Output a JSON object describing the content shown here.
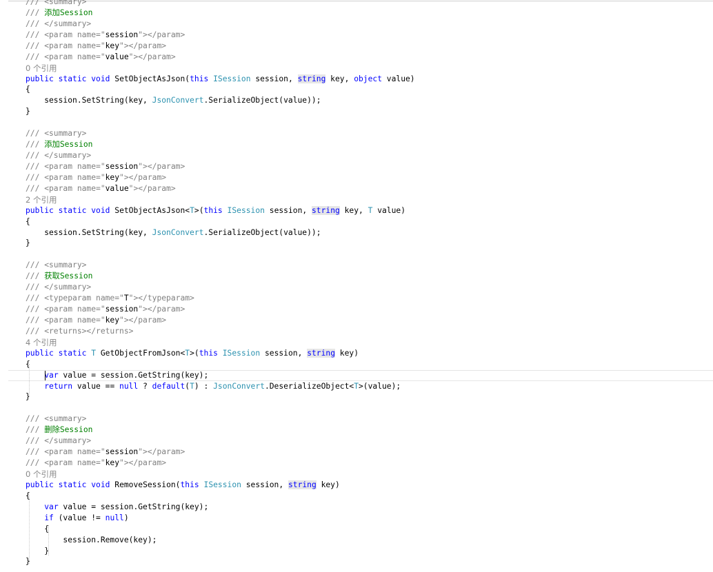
{
  "lines": [
    {
      "kind": "code",
      "tokens": [
        [
          "doc",
          "/// <summary>"
        ]
      ]
    },
    {
      "kind": "code",
      "tokens": [
        [
          "doc",
          "/// "
        ],
        [
          "com",
          "添加Session"
        ]
      ]
    },
    {
      "kind": "code",
      "tokens": [
        [
          "doc",
          "/// </summary>"
        ]
      ]
    },
    {
      "kind": "code",
      "tokens": [
        [
          "doc",
          "/// <param name=\""
        ],
        [
          "str",
          "session"
        ],
        [
          "doc",
          "\"></param>"
        ]
      ]
    },
    {
      "kind": "code",
      "tokens": [
        [
          "doc",
          "/// <param name=\""
        ],
        [
          "str",
          "key"
        ],
        [
          "doc",
          "\"></param>"
        ]
      ]
    },
    {
      "kind": "code",
      "tokens": [
        [
          "doc",
          "/// <param name=\""
        ],
        [
          "str",
          "value"
        ],
        [
          "doc",
          "\"></param>"
        ]
      ]
    },
    {
      "kind": "lens",
      "text": "0 个引用"
    },
    {
      "kind": "code",
      "tokens": [
        [
          "kw",
          "public"
        ],
        [
          "plain",
          " "
        ],
        [
          "kw",
          "static"
        ],
        [
          "plain",
          " "
        ],
        [
          "kw",
          "void"
        ],
        [
          "plain",
          " SetObjectAsJson("
        ],
        [
          "kw",
          "this"
        ],
        [
          "plain",
          " "
        ],
        [
          "type",
          "ISession"
        ],
        [
          "plain",
          " session, "
        ],
        [
          "kwhl",
          "string"
        ],
        [
          "plain",
          " key, "
        ],
        [
          "kw",
          "object"
        ],
        [
          "plain",
          " value)"
        ]
      ]
    },
    {
      "kind": "code",
      "tokens": [
        [
          "plain",
          "{"
        ]
      ]
    },
    {
      "kind": "code",
      "tokens": [
        [
          "plain",
          "    session.SetString(key, "
        ],
        [
          "type",
          "JsonConvert"
        ],
        [
          "plain",
          ".SerializeObject(value));"
        ]
      ]
    },
    {
      "kind": "code",
      "tokens": [
        [
          "plain",
          "}"
        ]
      ]
    },
    {
      "kind": "blank"
    },
    {
      "kind": "code",
      "tokens": [
        [
          "doc",
          "/// <summary>"
        ]
      ]
    },
    {
      "kind": "code",
      "tokens": [
        [
          "doc",
          "/// "
        ],
        [
          "com",
          "添加Session"
        ]
      ]
    },
    {
      "kind": "code",
      "tokens": [
        [
          "doc",
          "/// </summary>"
        ]
      ]
    },
    {
      "kind": "code",
      "tokens": [
        [
          "doc",
          "/// <param name=\""
        ],
        [
          "str",
          "session"
        ],
        [
          "doc",
          "\"></param>"
        ]
      ]
    },
    {
      "kind": "code",
      "tokens": [
        [
          "doc",
          "/// <param name=\""
        ],
        [
          "str",
          "key"
        ],
        [
          "doc",
          "\"></param>"
        ]
      ]
    },
    {
      "kind": "code",
      "tokens": [
        [
          "doc",
          "/// <param name=\""
        ],
        [
          "str",
          "value"
        ],
        [
          "doc",
          "\"></param>"
        ]
      ]
    },
    {
      "kind": "lens",
      "text": "2 个引用"
    },
    {
      "kind": "code",
      "tokens": [
        [
          "kw",
          "public"
        ],
        [
          "plain",
          " "
        ],
        [
          "kw",
          "static"
        ],
        [
          "plain",
          " "
        ],
        [
          "kw",
          "void"
        ],
        [
          "plain",
          " SetObjectAsJson<"
        ],
        [
          "type",
          "T"
        ],
        [
          "plain",
          ">("
        ],
        [
          "kw",
          "this"
        ],
        [
          "plain",
          " "
        ],
        [
          "type",
          "ISession"
        ],
        [
          "plain",
          " session, "
        ],
        [
          "kwhl",
          "string"
        ],
        [
          "plain",
          " key, "
        ],
        [
          "type",
          "T"
        ],
        [
          "plain",
          " value)"
        ]
      ]
    },
    {
      "kind": "code",
      "tokens": [
        [
          "plain",
          "{"
        ]
      ]
    },
    {
      "kind": "code",
      "tokens": [
        [
          "plain",
          "    session.SetString(key, "
        ],
        [
          "type",
          "JsonConvert"
        ],
        [
          "plain",
          ".SerializeObject(value));"
        ]
      ]
    },
    {
      "kind": "code",
      "tokens": [
        [
          "plain",
          "}"
        ]
      ]
    },
    {
      "kind": "blank"
    },
    {
      "kind": "code",
      "tokens": [
        [
          "doc",
          "/// <summary>"
        ]
      ]
    },
    {
      "kind": "code",
      "tokens": [
        [
          "doc",
          "/// "
        ],
        [
          "com",
          "获取Session"
        ]
      ]
    },
    {
      "kind": "code",
      "tokens": [
        [
          "doc",
          "/// </summary>"
        ]
      ]
    },
    {
      "kind": "code",
      "tokens": [
        [
          "doc",
          "/// <typeparam name=\""
        ],
        [
          "str",
          "T"
        ],
        [
          "doc",
          "\"></typeparam>"
        ]
      ]
    },
    {
      "kind": "code",
      "tokens": [
        [
          "doc",
          "/// <param name=\""
        ],
        [
          "str",
          "session"
        ],
        [
          "doc",
          "\"></param>"
        ]
      ]
    },
    {
      "kind": "code",
      "tokens": [
        [
          "doc",
          "/// <param name=\""
        ],
        [
          "str",
          "key"
        ],
        [
          "doc",
          "\"></param>"
        ]
      ]
    },
    {
      "kind": "code",
      "tokens": [
        [
          "doc",
          "/// <returns></returns>"
        ]
      ]
    },
    {
      "kind": "lens",
      "text": "4 个引用"
    },
    {
      "kind": "code",
      "tokens": [
        [
          "kw",
          "public"
        ],
        [
          "plain",
          " "
        ],
        [
          "kw",
          "static"
        ],
        [
          "plain",
          " "
        ],
        [
          "type",
          "T"
        ],
        [
          "plain",
          " GetObjectFromJson<"
        ],
        [
          "type",
          "T"
        ],
        [
          "plain",
          ">("
        ],
        [
          "kw",
          "this"
        ],
        [
          "plain",
          " "
        ],
        [
          "type",
          "ISession"
        ],
        [
          "plain",
          " session, "
        ],
        [
          "kwhl",
          "string"
        ],
        [
          "plain",
          " key)"
        ]
      ]
    },
    {
      "kind": "code",
      "tokens": [
        [
          "plain",
          "{"
        ]
      ]
    },
    {
      "kind": "code",
      "current": true,
      "tokens": [
        [
          "plain",
          "    "
        ],
        [
          "kw",
          "var"
        ],
        [
          "plain",
          " value = session.GetString(key);"
        ]
      ]
    },
    {
      "kind": "code",
      "tokens": [
        [
          "plain",
          "    "
        ],
        [
          "kw",
          "return"
        ],
        [
          "plain",
          " value == "
        ],
        [
          "kw",
          "null"
        ],
        [
          "plain",
          " ? "
        ],
        [
          "kw",
          "default"
        ],
        [
          "plain",
          "("
        ],
        [
          "type",
          "T"
        ],
        [
          "plain",
          ") : "
        ],
        [
          "type",
          "JsonConvert"
        ],
        [
          "plain",
          ".DeserializeObject<"
        ],
        [
          "type",
          "T"
        ],
        [
          "plain",
          ">(value);"
        ]
      ]
    },
    {
      "kind": "code",
      "tokens": [
        [
          "plain",
          "}"
        ]
      ]
    },
    {
      "kind": "blank"
    },
    {
      "kind": "code",
      "tokens": [
        [
          "doc",
          "/// <summary>"
        ]
      ]
    },
    {
      "kind": "code",
      "tokens": [
        [
          "doc",
          "/// "
        ],
        [
          "com",
          "删除Session"
        ]
      ]
    },
    {
      "kind": "code",
      "tokens": [
        [
          "doc",
          "/// </summary>"
        ]
      ]
    },
    {
      "kind": "code",
      "tokens": [
        [
          "doc",
          "/// <param name=\""
        ],
        [
          "str",
          "session"
        ],
        [
          "doc",
          "\"></param>"
        ]
      ]
    },
    {
      "kind": "code",
      "tokens": [
        [
          "doc",
          "/// <param name=\""
        ],
        [
          "str",
          "key"
        ],
        [
          "doc",
          "\"></param>"
        ]
      ]
    },
    {
      "kind": "lens",
      "text": "0 个引用"
    },
    {
      "kind": "code",
      "tokens": [
        [
          "kw",
          "public"
        ],
        [
          "plain",
          " "
        ],
        [
          "kw",
          "static"
        ],
        [
          "plain",
          " "
        ],
        [
          "kw",
          "void"
        ],
        [
          "plain",
          " RemoveSession("
        ],
        [
          "kw",
          "this"
        ],
        [
          "plain",
          " "
        ],
        [
          "type",
          "ISession"
        ],
        [
          "plain",
          " session, "
        ],
        [
          "kwhl",
          "string"
        ],
        [
          "plain",
          " key)"
        ]
      ]
    },
    {
      "kind": "code",
      "tokens": [
        [
          "plain",
          "{"
        ]
      ]
    },
    {
      "kind": "code",
      "tokens": [
        [
          "plain",
          "    "
        ],
        [
          "kw",
          "var"
        ],
        [
          "plain",
          " value = session.GetString(key);"
        ]
      ]
    },
    {
      "kind": "code",
      "tokens": [
        [
          "plain",
          "    "
        ],
        [
          "kw",
          "if"
        ],
        [
          "plain",
          " (value != "
        ],
        [
          "kw",
          "null"
        ],
        [
          "plain",
          ")"
        ]
      ]
    },
    {
      "kind": "code",
      "tokens": [
        [
          "plain",
          "    {"
        ]
      ]
    },
    {
      "kind": "code",
      "tokens": [
        [
          "plain",
          "        session.Remove(key);"
        ]
      ]
    },
    {
      "kind": "code",
      "tokens": [
        [
          "plain",
          "    }"
        ]
      ]
    },
    {
      "kind": "code",
      "tokens": [
        [
          "plain",
          "}"
        ]
      ]
    }
  ],
  "colors": {
    "keyword": "#0000ff",
    "type": "#2b91af",
    "comment": "#008000",
    "doc": "#808080",
    "lens": "#888888",
    "highlight": "#e6e6e6"
  }
}
